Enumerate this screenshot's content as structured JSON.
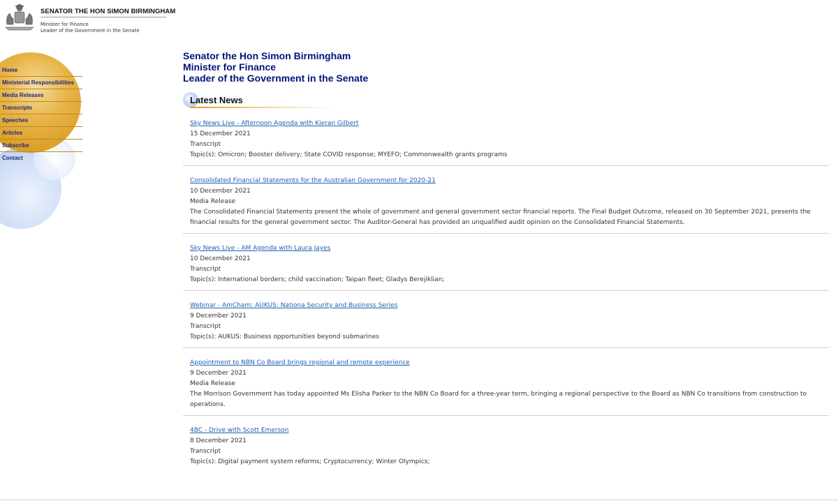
{
  "header": {
    "title": "SENATOR THE HON SIMON BIRMINGHAM",
    "subtitle_line1": "Minister for Finance",
    "subtitle_line2": "Leader of the Government in the Senate",
    "crest_icon": "coat-of-arms-icon"
  },
  "nav": {
    "items": [
      {
        "label": "Home"
      },
      {
        "label": "Ministerial Responsibilities"
      },
      {
        "label": "Media Releases"
      },
      {
        "label": "Transcripts"
      },
      {
        "label": "Speeches"
      },
      {
        "label": "Articles"
      },
      {
        "label": "Subscribe"
      },
      {
        "label": "Contact"
      }
    ]
  },
  "main": {
    "title_lines": [
      "Senator the Hon Simon Birmingham",
      "Minister for Finance",
      "Leader of the Government in the Senate"
    ],
    "section_heading": "Latest News",
    "news": [
      {
        "title": "Sky News Live - Afternoon Agenda with Kieran Gilbert",
        "date": "15 December 2021",
        "type": "Transcript",
        "summary": "Topic(s): Omicron; Booster delivery; State COVID response; MYEFO; Commonwealth grants programs"
      },
      {
        "title": "Consolidated Financial Statements for the Australian Government for 2020-21",
        "date": "10 December 2021",
        "type": "Media Release",
        "summary": "The Consolidated Financial Statements present the whole of government and general government sector financial reports. The Final Budget Outcome, released on 30 September 2021, presents the financial results for the general government sector. The Auditor-General has provided an unqualified audit opinion on the Consolidated Financial Statements."
      },
      {
        "title": "Sky News Live - AM Agenda with Laura Jayes",
        "date": "10 December 2021",
        "type": "Transcript",
        "summary": "Topic(s): International borders; child vaccination; Taipan fleet; Gladys Berejiklian;"
      },
      {
        "title": "Webinar - AmCham: AUKUS: Nationa Security and Business Series",
        "date": "9 December 2021",
        "type": "Transcript",
        "summary": "Topic(s): AUKUS: Business opportunities beyond submarines"
      },
      {
        "title": "Appointment to NBN Co Board brings regional and remote experience",
        "date": "9 December 2021",
        "type": "Media Release",
        "summary": "The Morrison Government has today appointed Ms Elisha Parker to the NBN Co Board for a three-year term, bringing a regional perspective to the Board as NBN Co transitions from construction to operations."
      },
      {
        "title": "4BC - Drive with Scott Emerson",
        "date": "8 December 2021",
        "type": "Transcript",
        "summary": "Topic(s): Digital payment system reforms; Cryptocurrency; Winter Olympics;"
      }
    ]
  },
  "colors": {
    "nav_gold": "#e0a62e",
    "title_blue": "#00147a",
    "link_blue": "#1f5fb0",
    "bubble_blue": "#c6d5f3"
  }
}
